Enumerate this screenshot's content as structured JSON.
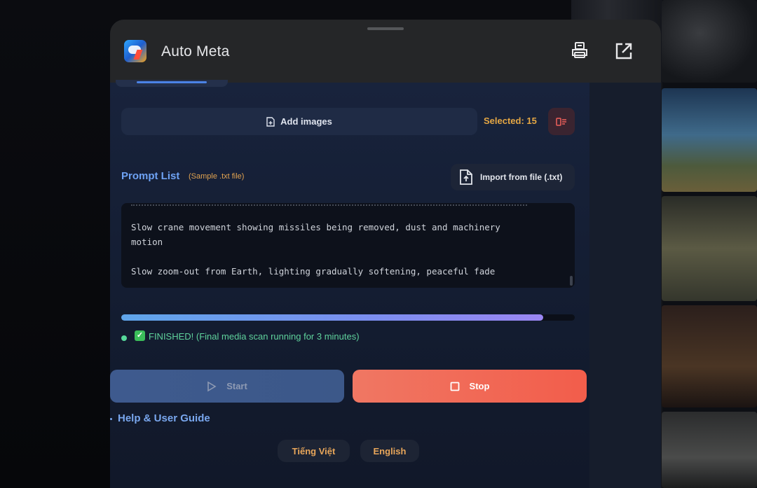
{
  "app": {
    "title": "Auto Meta",
    "icons": {
      "app": "app-logo-icon",
      "settings": "printer-icon",
      "popout": "external-link-icon"
    }
  },
  "images": {
    "add_label": "Add images",
    "selected_text": "Selected: 15",
    "add_icon": "file-plus-icon",
    "clear_icon": "clear-list-icon"
  },
  "prompt_list": {
    "title": "Prompt List",
    "sample_hint": "(Sample .txt file)",
    "import_label": "Import from file (.txt)",
    "import_icon": "file-upload-icon",
    "lines": [
      "Slow crane movement showing missiles being removed, dust and machinery",
      "motion",
      "",
      "Slow zoom-out from Earth, lighting gradually softening, peaceful fade"
    ]
  },
  "progress": {
    "percent": 93,
    "status_text": "FINISHED! (Final media scan running for 3 minutes)"
  },
  "controls": {
    "start_label": "Start",
    "stop_label": "Stop"
  },
  "help": {
    "label": "Help & User Guide"
  },
  "languages": {
    "vi": "Tiếng Việt",
    "en": "English"
  },
  "colors": {
    "accent_blue": "#6ea2f4",
    "selected_orange": "#e5a744",
    "status_green": "#5fd29c",
    "stop_red": "#f25d4b"
  }
}
